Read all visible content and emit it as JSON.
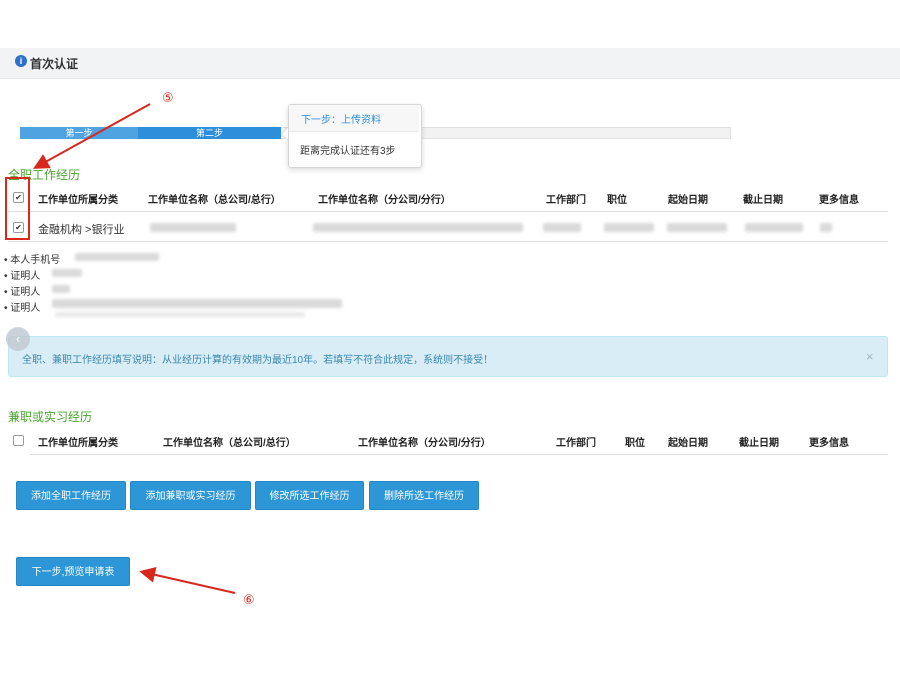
{
  "header": {
    "info_icon": "i",
    "title": "首次认证"
  },
  "progress": {
    "step1_label": "第一步",
    "step2_label": "第二步"
  },
  "popover": {
    "title": "下一步：上传资料",
    "body": "距离完成认证还有3步"
  },
  "fulltime": {
    "title": "全职工作经历",
    "columns": [
      "工作单位所属分类",
      "工作单位名称（总公司/总行）",
      "工作单位名称（分公司/分行）",
      "工作部门",
      "职位",
      "起始日期",
      "截止日期",
      "更多信息"
    ],
    "rows": [
      {
        "category": "金融机构 >银行业",
        "checked": "✔"
      }
    ],
    "header_check": "✔",
    "details": [
      "本人手机号",
      "证明人",
      "证明人",
      "证明人"
    ]
  },
  "alert": {
    "text": "全职、兼职工作经历填写说明：从业经历计算的有效期为最近10年。若填写不符合此规定，系统则不接受！",
    "close": "×"
  },
  "parttime": {
    "title": "兼职或实习经历",
    "columns": [
      "工作单位所属分类",
      "工作单位名称（总公司/总行）",
      "工作单位名称（分公司/分行）",
      "工作部门",
      "职位",
      "起始日期",
      "截止日期",
      "更多信息"
    ]
  },
  "buttons": {
    "add_fulltime": "添加全职工作经历",
    "add_parttime": "添加兼职或实习经历",
    "edit_selected": "修改所选工作经历",
    "delete_selected": "删除所选工作经历",
    "next": "下一步,预览申请表"
  },
  "annotations": {
    "five": "⑤",
    "six": "⑥"
  },
  "colors": {
    "accent": "#2d96d7",
    "section_title": "#4aa331",
    "annotation_red": "#d8281d",
    "alert_bg": "#d9edf7"
  }
}
